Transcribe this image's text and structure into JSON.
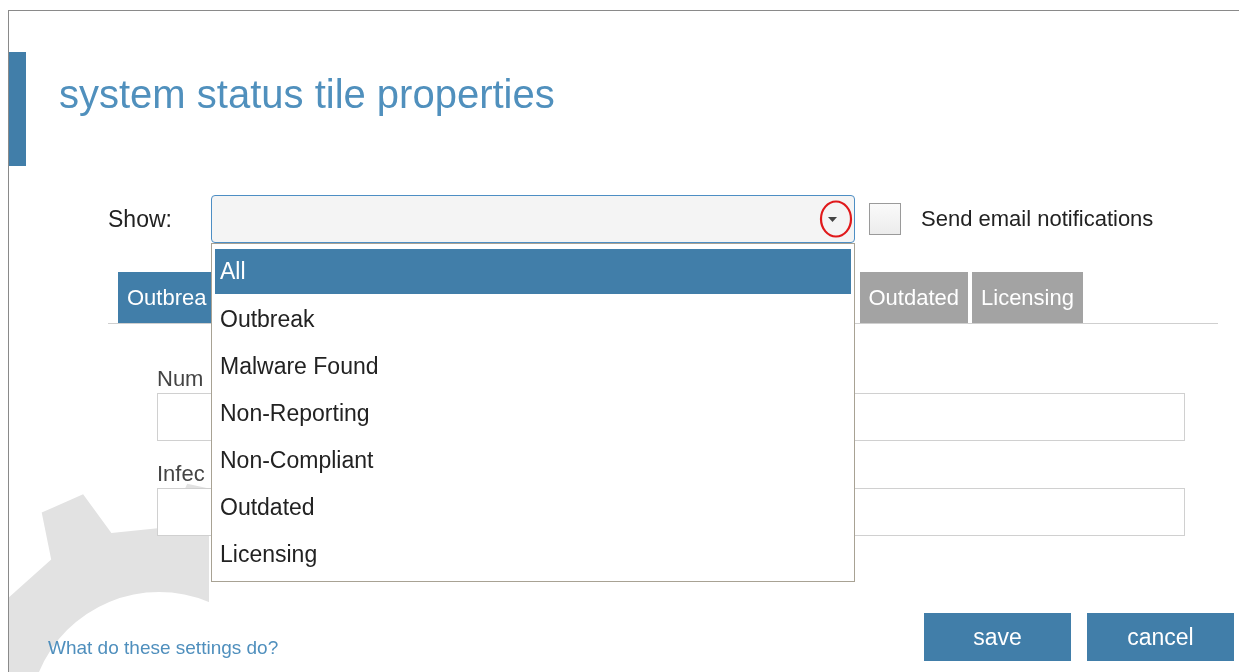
{
  "dialog": {
    "title": "system status tile properties"
  },
  "show": {
    "label": "Show:",
    "expanded": true,
    "options": [
      {
        "label": "All",
        "selected": true
      },
      {
        "label": "Outbreak",
        "selected": false
      },
      {
        "label": "Malware Found",
        "selected": false
      },
      {
        "label": "Non-Reporting",
        "selected": false
      },
      {
        "label": "Non-Compliant",
        "selected": false
      },
      {
        "label": "Outdated",
        "selected": false
      },
      {
        "label": "Licensing",
        "selected": false
      }
    ]
  },
  "email_notifications": {
    "label": "Send email notifications",
    "checked": false
  },
  "tabs": [
    {
      "label": "Outbrea",
      "selected": true
    },
    {
      "label": "Outdated",
      "selected": false
    },
    {
      "label": "Licensing",
      "selected": false
    }
  ],
  "fields": [
    {
      "label": "Num"
    },
    {
      "label": "Infec"
    }
  ],
  "help_link": "What do these settings do?",
  "buttons": [
    {
      "label": "save"
    },
    {
      "label": "cancel"
    }
  ]
}
